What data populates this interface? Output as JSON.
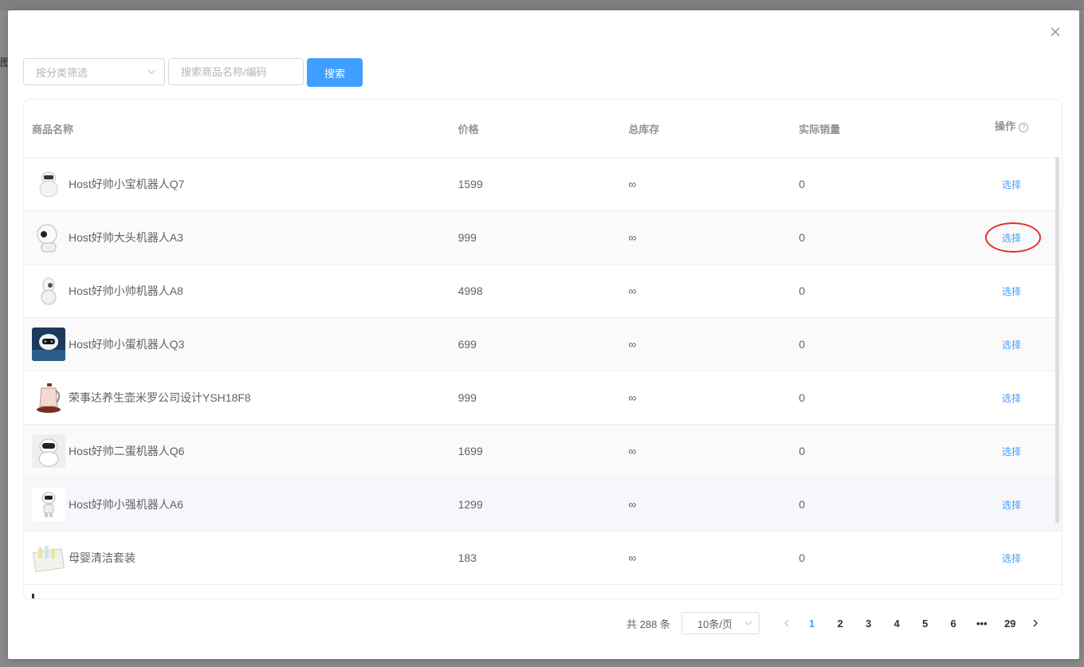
{
  "colors": {
    "primary": "#409eff",
    "highlight_circle": "#e0302a"
  },
  "background": {
    "partial_text": "图"
  },
  "filter": {
    "category_placeholder": "按分类筛选",
    "search_placeholder": "搜索商品名称/编码",
    "search_label": "搜索"
  },
  "table": {
    "headers": {
      "name": "商品名称",
      "price": "价格",
      "stock": "总库存",
      "sales": "实际销量",
      "op": "操作"
    },
    "rows": [
      {
        "name": "Host好帅小宝机器人Q7",
        "price": "1599",
        "stock": "∞",
        "sales": "0",
        "action": "选择",
        "thumb": "white-robot"
      },
      {
        "name": "Host好帅大头机器人A3",
        "price": "999",
        "stock": "∞",
        "sales": "0",
        "action": "选择",
        "thumb": "bighead-robot"
      },
      {
        "name": "Host好帅小帅机器人A8",
        "price": "4998",
        "stock": "∞",
        "sales": "0",
        "action": "选择",
        "thumb": "egg-robot"
      },
      {
        "name": "Host好帅小蛋机器人Q3",
        "price": "699",
        "stock": "∞",
        "sales": "0",
        "action": "选择",
        "thumb": "dark-robot"
      },
      {
        "name": "荣事达养生壶米罗公司设计YSH18F8",
        "price": "999",
        "stock": "∞",
        "sales": "0",
        "action": "选择",
        "thumb": "kettle"
      },
      {
        "name": "Host好帅二蛋机器人Q6",
        "price": "1699",
        "stock": "∞",
        "sales": "0",
        "action": "选择",
        "thumb": "round-robot"
      },
      {
        "name": "Host好帅小强机器人A6",
        "price": "1299",
        "stock": "∞",
        "sales": "0",
        "action": "选择",
        "thumb": "small-robot"
      },
      {
        "name": "母婴清洁套装",
        "price": "183",
        "stock": "∞",
        "sales": "0",
        "action": "选择",
        "thumb": "baby-set"
      }
    ]
  },
  "pagination": {
    "total_text": "共 288 条",
    "page_size": "10条/页",
    "pages": [
      "1",
      "2",
      "3",
      "4",
      "5",
      "6",
      "•••",
      "29"
    ],
    "current": "1"
  }
}
